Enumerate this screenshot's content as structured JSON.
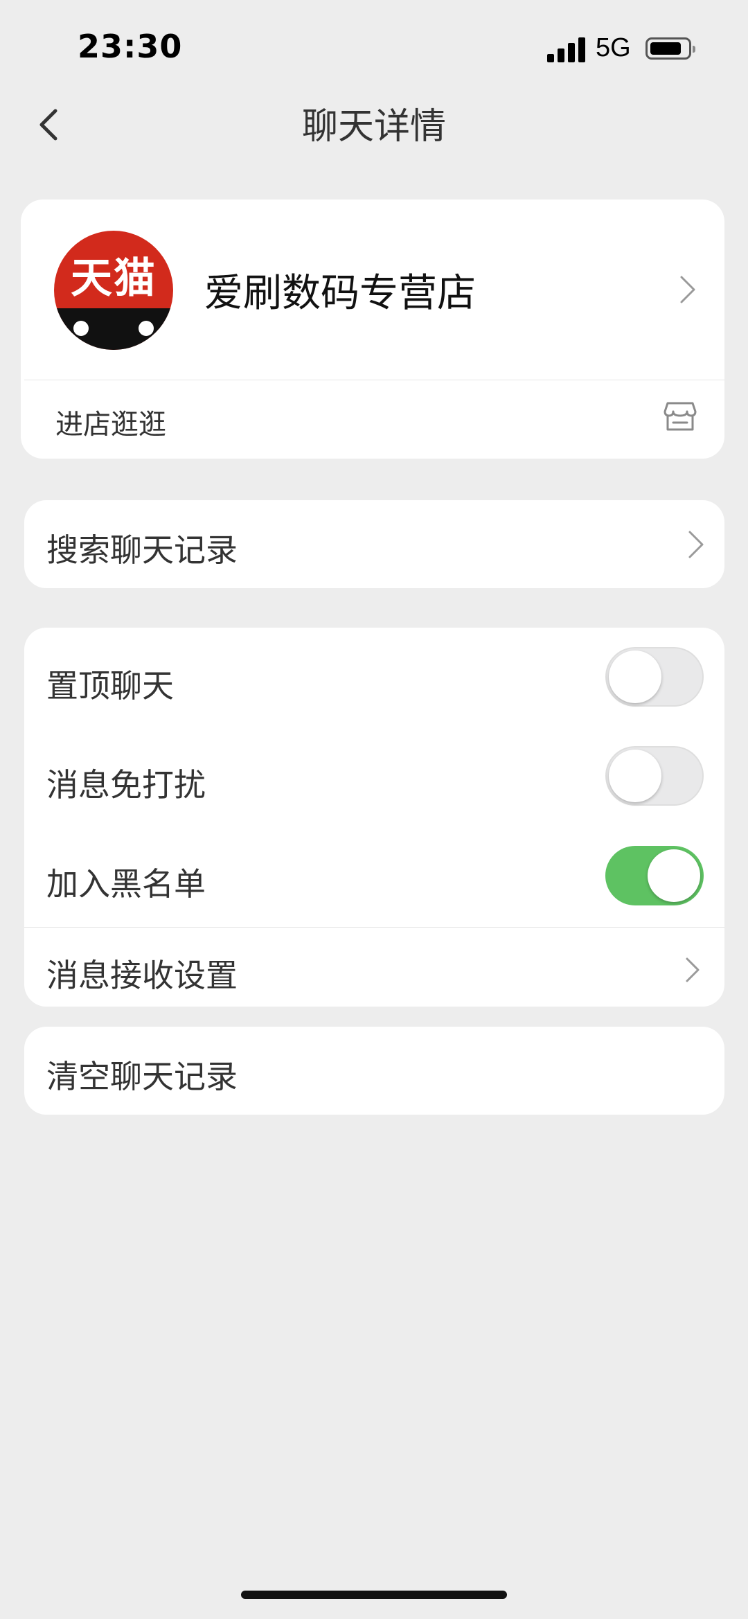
{
  "status_bar": {
    "time": "23:30",
    "network": "5G",
    "signal_icon": "signal-bars-icon",
    "battery_icon": "battery-icon"
  },
  "nav": {
    "title": "聊天详情",
    "back_icon": "back-arrow-icon"
  },
  "store_card": {
    "avatar_text": "天猫",
    "store_name": "爱刷数码专营店",
    "visit_label": "进店逛逛",
    "visit_icon": "storefront-icon"
  },
  "search_row": {
    "label": "搜索聊天记录"
  },
  "settings": {
    "pin_chat": {
      "label": "置顶聊天",
      "on": false
    },
    "mute": {
      "label": "消息免打扰",
      "on": false
    },
    "blacklist": {
      "label": "加入黑名单",
      "on": true
    },
    "receive_settings": {
      "label": "消息接收设置"
    }
  },
  "clear_row": {
    "label": "清空聊天记录"
  },
  "colors": {
    "background": "#ededed",
    "card": "#ffffff",
    "toggle_on": "#5ec262",
    "avatar_red": "#d22a1c"
  }
}
